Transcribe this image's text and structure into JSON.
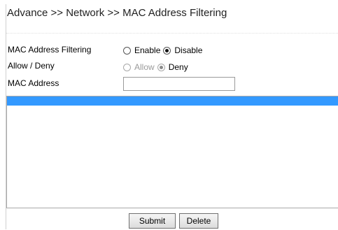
{
  "page": {
    "title": "Advance >> Network >> MAC Address Filtering"
  },
  "form": {
    "mac_filtering": {
      "label": "MAC Address Filtering",
      "options": [
        "Enable",
        "Disable"
      ],
      "selected": "Disable"
    },
    "allow_deny": {
      "label": "Allow / Deny",
      "options": [
        "Allow",
        "Deny"
      ],
      "selected": "Deny",
      "disabled": true
    },
    "mac_address": {
      "label": "MAC Address",
      "value": ""
    }
  },
  "mac_list": {
    "header_color": "#3399ff",
    "items": []
  },
  "buttons": {
    "submit": "Submit",
    "delete": "Delete"
  }
}
